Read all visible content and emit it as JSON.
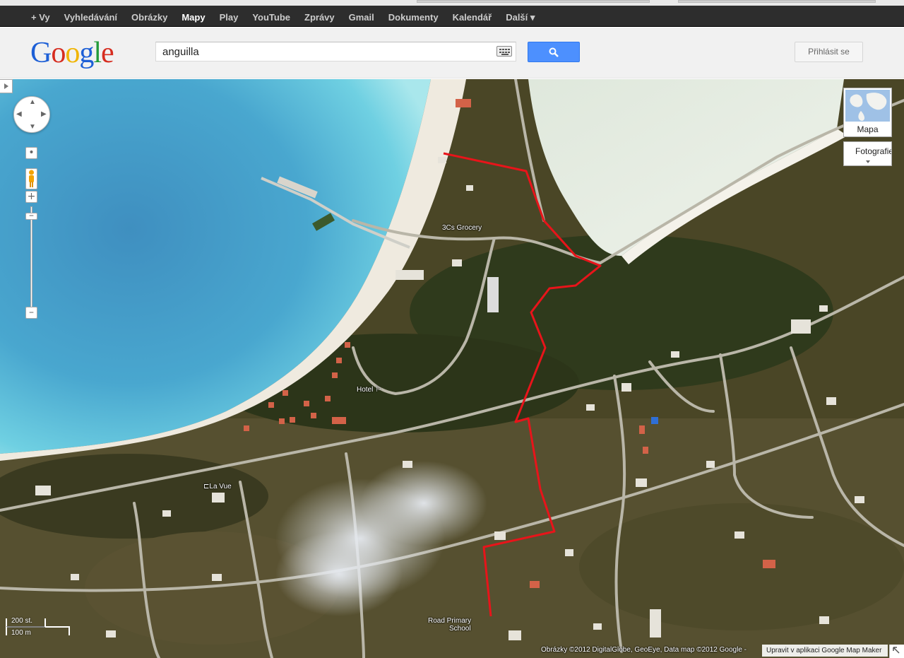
{
  "topbar": {
    "items": [
      {
        "label": "+ Vy",
        "active": false
      },
      {
        "label": "Vyhledávání",
        "active": false
      },
      {
        "label": "Obrázky",
        "active": false
      },
      {
        "label": "Mapy",
        "active": true
      },
      {
        "label": "Play",
        "active": false
      },
      {
        "label": "YouTube",
        "active": false
      },
      {
        "label": "Zprávy",
        "active": false
      },
      {
        "label": "Gmail",
        "active": false
      },
      {
        "label": "Dokumenty",
        "active": false
      },
      {
        "label": "Kalendář",
        "active": false
      },
      {
        "label": "Další ▾",
        "active": false
      }
    ]
  },
  "header": {
    "logo": "Google",
    "search_value": "anguilla",
    "signin_label": "Přihlásit se"
  },
  "map": {
    "layer_label": "Mapa",
    "foto_label": "Fotografie",
    "labels": {
      "grocery": "3Cs Grocery",
      "hotel": "Hotel",
      "lavue": "La Vue",
      "school_1": "Road Primary",
      "school_2": "School"
    },
    "scale": {
      "imperial": "200 st.",
      "metric": "100 m"
    },
    "attribution": "Obrázky ©2012 DigitalGlobe, GeoEye, Data map ©2012 Google -",
    "mapmaker": "Upravit v aplikaci Google Map Maker"
  },
  "colors": {
    "route": "#e8141a",
    "search_button": "#4d90fe",
    "topbar": "#2d2d2d"
  }
}
